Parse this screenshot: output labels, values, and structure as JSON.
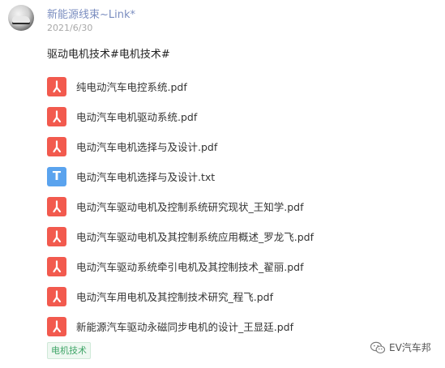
{
  "post": {
    "username": "新能源线束~Link*",
    "date": "2021/6/30",
    "title": "驱动电机技术#电机技术#",
    "files": [
      {
        "type": "pdf",
        "icon": "pdf-icon",
        "name": "纯电动汽车电控系统.pdf"
      },
      {
        "type": "pdf",
        "icon": "pdf-icon",
        "name": "电动汽车电机驱动系统.pdf"
      },
      {
        "type": "pdf",
        "icon": "pdf-icon",
        "name": "电动汽车电机选择与及设计.pdf"
      },
      {
        "type": "txt",
        "icon": "txt-icon",
        "name": "电动汽车电机选择与及设计.txt"
      },
      {
        "type": "pdf",
        "icon": "pdf-icon",
        "name": "电动汽车驱动电机及控制系统研究现状_王知学.pdf"
      },
      {
        "type": "pdf",
        "icon": "pdf-icon",
        "name": "电动汽车驱动电机及其控制系统应用概述_罗龙飞.pdf"
      },
      {
        "type": "pdf",
        "icon": "pdf-icon",
        "name": "电动汽车驱动系统牵引电机及其控制技术_翟丽.pdf"
      },
      {
        "type": "pdf",
        "icon": "pdf-icon",
        "name": "电动汽车用电机及其控制技术研究_程飞.pdf"
      },
      {
        "type": "pdf",
        "icon": "pdf-icon",
        "name": "新能源汽车驱动永磁同步电机的设计_王显廷.pdf"
      }
    ],
    "tag": "电机技术"
  },
  "watermark": {
    "icon": "wechat-icon",
    "text": "EV汽车邦"
  },
  "colors": {
    "username": "#7b8ec0",
    "pdf_icon": "#f25a4e",
    "txt_icon": "#5aa3ee",
    "tag_text": "#3fa567"
  }
}
